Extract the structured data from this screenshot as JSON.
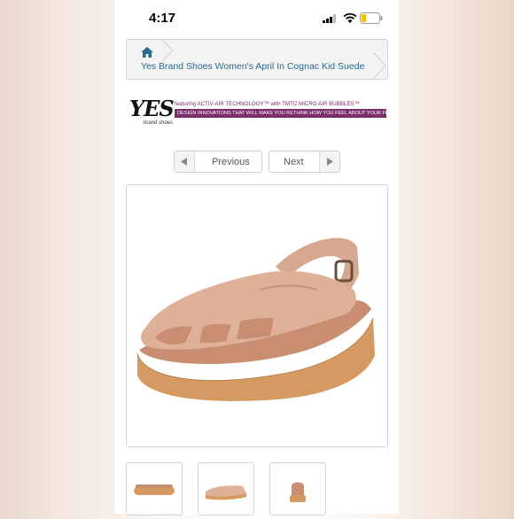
{
  "status_bar": {
    "time": "4:17"
  },
  "breadcrumb": {
    "title": "Yes Brand Shoes Women's April In Cognac Kid Suede"
  },
  "brand": {
    "logo_text": "YES",
    "logo_sub": "brand shoes",
    "featuring": "featuring ACTIV-AIR TECHNOLOGY™ with TMTC MICRO AIR BUBBLES™",
    "tagline": "DESIGN INNOVATIONS THAT WILL MAKE YOU RETHINK HOW YOU FEEL ABOUT YOUR FEET"
  },
  "pager": {
    "prev_label": "Previous",
    "next_label": "Next"
  },
  "colors": {
    "link": "#2a6a8a",
    "brand_band": "#7b2d6c",
    "suede": "#d9ab92",
    "sole": "#d59a62"
  },
  "icons": {
    "home": "home-icon",
    "prev": "chevron-left-icon",
    "next": "chevron-right-icon"
  }
}
